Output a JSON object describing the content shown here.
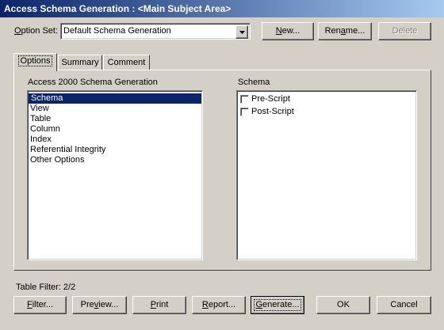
{
  "window": {
    "title": "Access Schema Generation : <Main Subject Area>"
  },
  "option_set": {
    "label_prefix": "O",
    "label_rest": "ption Set:",
    "value": "Default Schema Generation"
  },
  "top_buttons": {
    "new": {
      "pre": "",
      "u": "N",
      "post": "ew..."
    },
    "rename": {
      "pre": "Ren",
      "u": "a",
      "post": "me..."
    },
    "delete": {
      "label": "Delete",
      "disabled": true
    }
  },
  "tabs": [
    {
      "label": "Options",
      "active": true
    },
    {
      "label": "Summary",
      "active": false
    },
    {
      "label": "Comment",
      "active": false
    }
  ],
  "left_panel": {
    "title": "Access 2000 Schema Generation",
    "items": [
      {
        "label": "Schema",
        "selected": true
      },
      {
        "label": "View",
        "selected": false
      },
      {
        "label": "Table",
        "selected": false
      },
      {
        "label": "Column",
        "selected": false
      },
      {
        "label": "Index",
        "selected": false
      },
      {
        "label": "Referential Integrity",
        "selected": false
      },
      {
        "label": "Other Options",
        "selected": false
      }
    ]
  },
  "right_panel": {
    "title": "Schema",
    "options": [
      {
        "label": "Pre-Script",
        "checked": false
      },
      {
        "label": "Post-Script",
        "checked": false
      }
    ]
  },
  "table_filter": "Table Filter: 2/2",
  "bottom_buttons": {
    "filter": {
      "pre": "",
      "u": "F",
      "post": "ilter..."
    },
    "preview": {
      "pre": "Pre",
      "u": "v",
      "post": "iew..."
    },
    "print": {
      "pre": "",
      "u": "P",
      "post": "rint"
    },
    "report": {
      "pre": "",
      "u": "R",
      "post": "eport..."
    },
    "generate": {
      "pre": "",
      "u": "G",
      "post": "enerate..."
    },
    "ok": {
      "label": "OK"
    },
    "cancel": {
      "label": "Cancel"
    }
  },
  "colors": {
    "title_gradient_start": "#0a246a",
    "title_gradient_end": "#a6caf0",
    "dialog_face": "#d4d0c8",
    "selection": "#0a246a"
  }
}
